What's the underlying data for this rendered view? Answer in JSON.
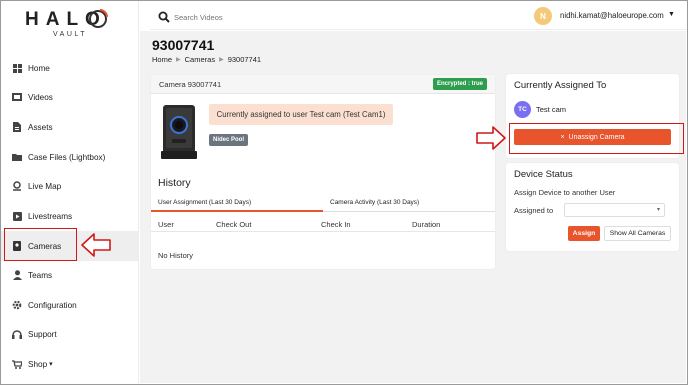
{
  "brand": {
    "name": "HALO",
    "sub": "VAULT",
    "accent_color": "#e8542c"
  },
  "sidebar": {
    "items": [
      {
        "label": "Home",
        "icon": "grid-icon"
      },
      {
        "label": "Videos",
        "icon": "film-icon"
      },
      {
        "label": "Assets",
        "icon": "document-icon"
      },
      {
        "label": "Case Files (Lightbox)",
        "icon": "folder-icon"
      },
      {
        "label": "Live Map",
        "icon": "map-pin-icon"
      },
      {
        "label": "Livestreams",
        "icon": "video-icon"
      },
      {
        "label": "Cameras",
        "icon": "bodycam-icon"
      },
      {
        "label": "Teams",
        "icon": "person-icon"
      },
      {
        "label": "Configuration",
        "icon": "gear-icon"
      },
      {
        "label": "Support",
        "icon": "headset-icon"
      },
      {
        "label": "Shop",
        "icon": "cart-icon",
        "caret": "▾"
      }
    ],
    "active": "Cameras"
  },
  "header": {
    "search_placeholder": "Search Videos",
    "user_initial": "N",
    "user_email": "nidhi.kamat@haloeurope.com"
  },
  "page": {
    "title": "93007741",
    "breadcrumb": [
      "Home",
      "Cameras",
      "93007741"
    ]
  },
  "camera_card": {
    "title": "Camera 93007741",
    "encrypted_badge": "Encrypted : true",
    "assigned_message": "Currently assigned to user Test cam (Test Cam1)",
    "pool_badge": "Nidec Pool",
    "history_title": "History",
    "tabs": [
      "User Assignment (Last 30 Days)",
      "Camera Activity (Last 30 Days)"
    ],
    "columns": [
      "User",
      "Check Out",
      "Check In",
      "Duration"
    ],
    "empty_text": "No History"
  },
  "assigned_card": {
    "title": "Currently Assigned To",
    "user_initials": "TC",
    "user_name": "Test cam",
    "unassign_icon": "×",
    "unassign_label": "Unassign Camera"
  },
  "device_status": {
    "title": "Device Status",
    "subtitle": "Assign Device to another User",
    "assigned_to_label": "Assigned to",
    "select_value": "",
    "assign_label": "Assign",
    "show_all_label": "Show All Cameras"
  }
}
